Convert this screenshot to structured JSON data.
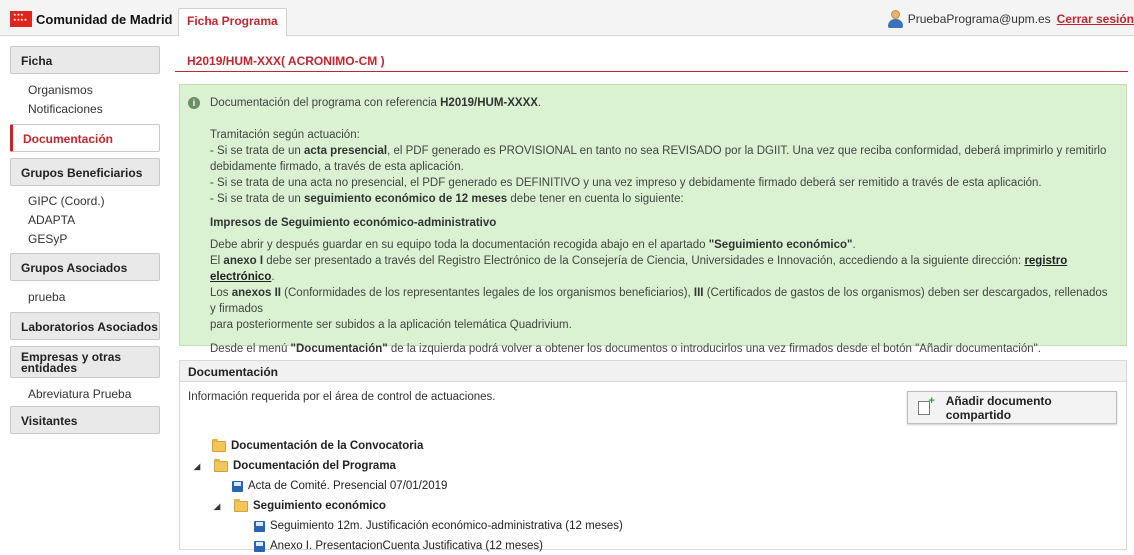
{
  "header": {
    "brand": "Comunidad de Madrid",
    "active_tab": "Ficha Programa",
    "user_email": "PruebaPrograma@upm.es",
    "logout": "Cerrar sesión"
  },
  "sidebar": {
    "ficha": "Ficha",
    "ficha_items": [
      "Organismos",
      "Notificaciones"
    ],
    "documentacion": "Documentación",
    "grupos_beneficiarios": "Grupos Beneficiarios",
    "beneficiarios_items": [
      "GIPC (Coord.)",
      "ADAPTA",
      "GESyP"
    ],
    "grupos_asociados": "Grupos Asociados",
    "asociados_items": [
      "prueba"
    ],
    "laboratorios": "Laboratorios Asociados",
    "empresas_line1": "Empresas y otras",
    "empresas_line2": "entidades",
    "empresas_items": [
      "Abreviatura Prueba"
    ],
    "visitantes": "Visitantes"
  },
  "main": {
    "title": "H2019/HUM-XXX( ACRONIMO-CM )",
    "info": {
      "intro_prefix": "Documentación del programa con referencia ",
      "intro_ref": "H2019/HUM-XXXX",
      "intro_suffix": ".",
      "tramitacion": "Tramitación según actuación:",
      "l1_a": "- Si se trata de un ",
      "l1_b": "acta presencial",
      "l1_c": ", el PDF generado es PROVISIONAL en tanto no sea REVISADO por la DGIIT. Una vez que reciba conformidad, deberá imprimirlo y remitirlo",
      "l1_d": "debidamente firmado, a través de esta aplicación.",
      "l2": "- Si se trata de una acta no presencial, el PDF generado es DEFINITIVO y una vez impreso y debidamente firmado deberá ser remitido a través de esta aplicación.",
      "l3_a": "- Si se trata de un ",
      "l3_b": "seguimiento económico de 12 meses",
      "l3_c": " debe tener en cuenta lo siguiente:",
      "impresos": "Impresos de Seguimiento económico-administrativo",
      "p1_a": "Debe abrir y después guardar en su equipo toda la documentación recogida abajo en el apartado ",
      "p1_b": "\"Seguimiento económico\"",
      "p1_c": ".",
      "p2_a": "El ",
      "p2_b": "anexo I",
      "p2_c": " debe ser presentado a través del Registro Electrónico de la Consejería de Ciencia, Universidades e Innovación, accediendo a la siguiente dirección: ",
      "p2_link": "registro electrónico",
      "p2_d": ".",
      "p3_a": "Los ",
      "p3_b": "anexos II",
      "p3_c": " (Conformidades de los representantes legales de los organismos beneficiarios), ",
      "p3_d": "III",
      "p3_e": " (Certificados de gastos de los organismos) deben ser descargados, rellenados y firmados",
      "p3_f": "para posteriormente ser subidos a la aplicación telemática Quadrivium.",
      "p4_a": "Desde el menú ",
      "p4_b": "\"Documentación\"",
      "p4_c": " de la izquierda podrá volver a obtener los documentos o introducirlos una vez firmados desde el botón \"Añadir documentación\"."
    },
    "panel": {
      "title": "Documentación",
      "subtitle": "Información requerida por el área de control de actuaciones.",
      "add_button": "Añadir documento compartido",
      "tree": [
        "Documentación de la Convocatoria",
        "Documentación del Programa",
        "Acta de Comité. Presencial 07/01/2019",
        "Seguimiento económico",
        "Seguimiento 12m. Justificación económico-administrativa (12 meses)",
        "Anexo I. PresentacionCuenta Justificativa (12 meses)"
      ]
    }
  }
}
